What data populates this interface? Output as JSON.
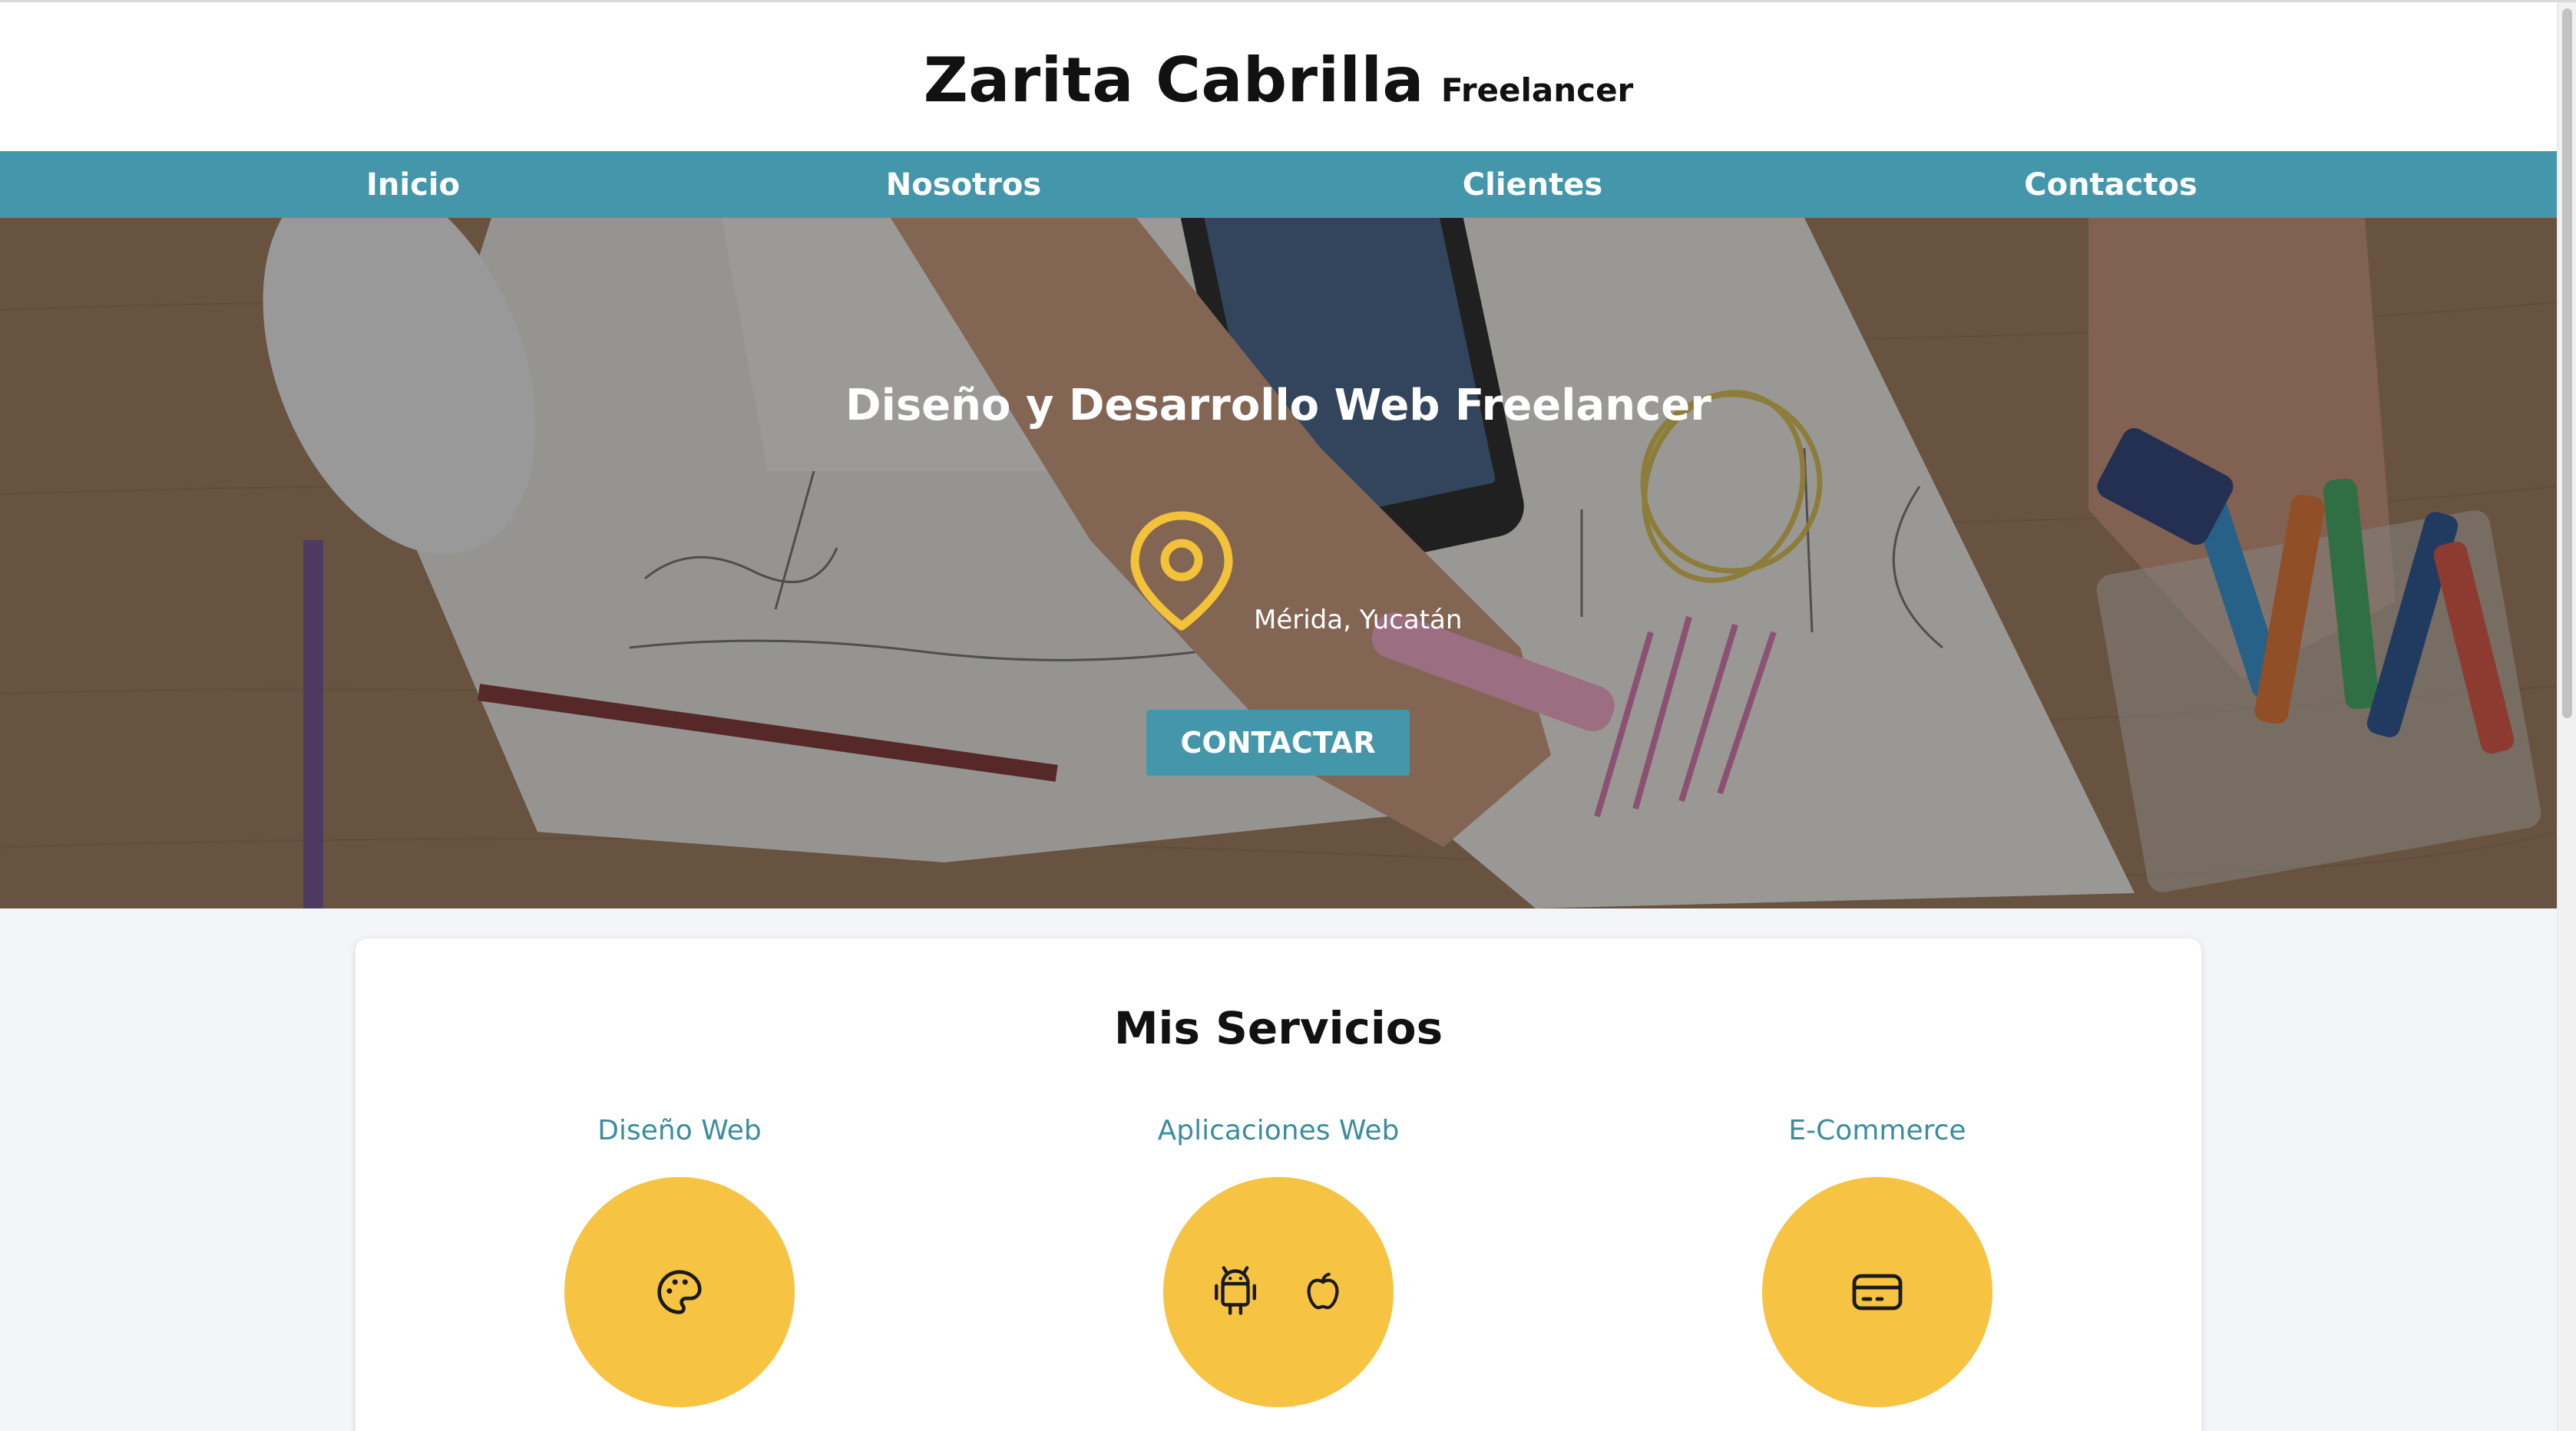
{
  "header": {
    "name": "Zarita Cabrilla",
    "tagline": "Freelancer"
  },
  "nav": {
    "items": [
      "Inicio",
      "Nosotros",
      "Clientes",
      "Contactos"
    ]
  },
  "hero": {
    "title": "Diseño y Desarrollo Web Freelancer",
    "location": "Mérida, Yucatán",
    "cta": "CONTACTAR"
  },
  "services": {
    "title": "Mis Servicios",
    "items": [
      {
        "label": "Diseño Web",
        "icons": [
          "palette-icon"
        ]
      },
      {
        "label": "Aplicaciones Web",
        "icons": [
          "android-icon",
          "apple-icon"
        ]
      },
      {
        "label": "E-Commerce",
        "icons": [
          "credit-card-icon"
        ]
      }
    ]
  },
  "colors": {
    "accent": "#4497aa",
    "highlight": "#f6c342",
    "link": "#3b8d9e"
  }
}
